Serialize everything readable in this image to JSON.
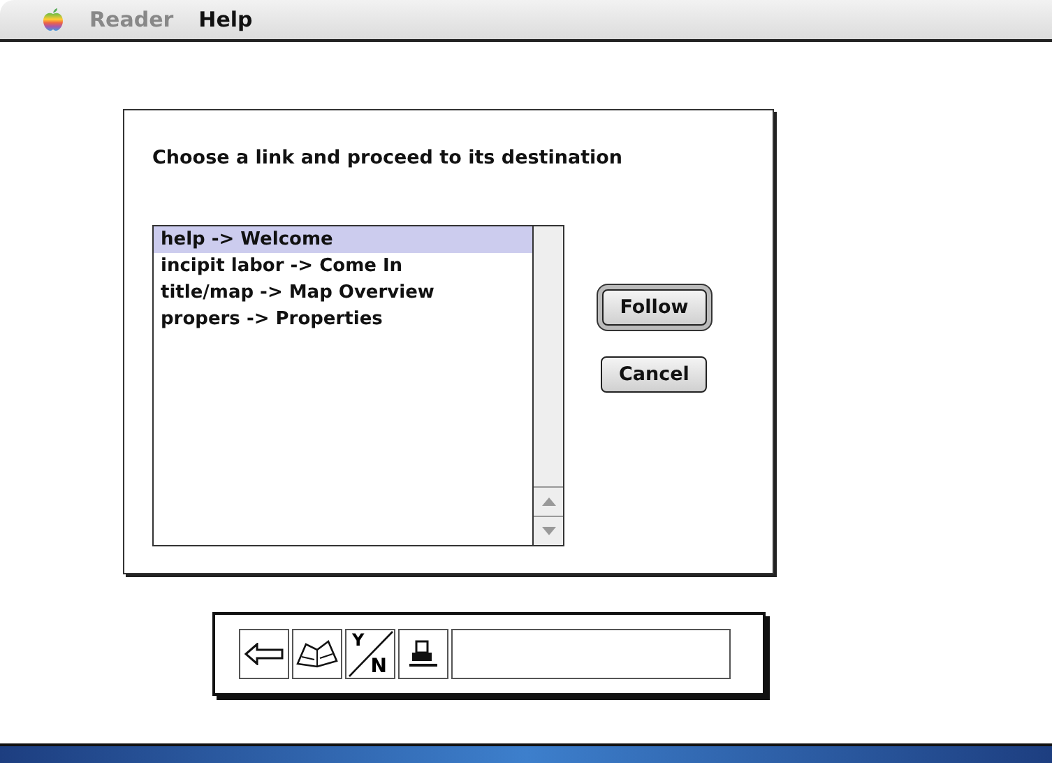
{
  "menu_bar": {
    "items": [
      {
        "label": "Reader",
        "disabled": true
      },
      {
        "label": "Help",
        "disabled": false
      }
    ]
  },
  "dialog": {
    "prompt": "Choose a link and proceed to its destination",
    "links": [
      {
        "label": "help -> Welcome",
        "selected": true
      },
      {
        "label": "incipit labor -> Come In",
        "selected": false
      },
      {
        "label": "title/map -> Map Overview",
        "selected": false
      },
      {
        "label": "propers -> Properties",
        "selected": false
      }
    ],
    "buttons": [
      {
        "label": "Follow",
        "default": true
      },
      {
        "label": "Cancel",
        "default": false
      }
    ]
  },
  "toolbar": {
    "tools": [
      {
        "kind": "back"
      },
      {
        "kind": "book"
      },
      {
        "kind": "yes-no",
        "y": "Y",
        "n": "N"
      },
      {
        "kind": "print"
      }
    ]
  }
}
